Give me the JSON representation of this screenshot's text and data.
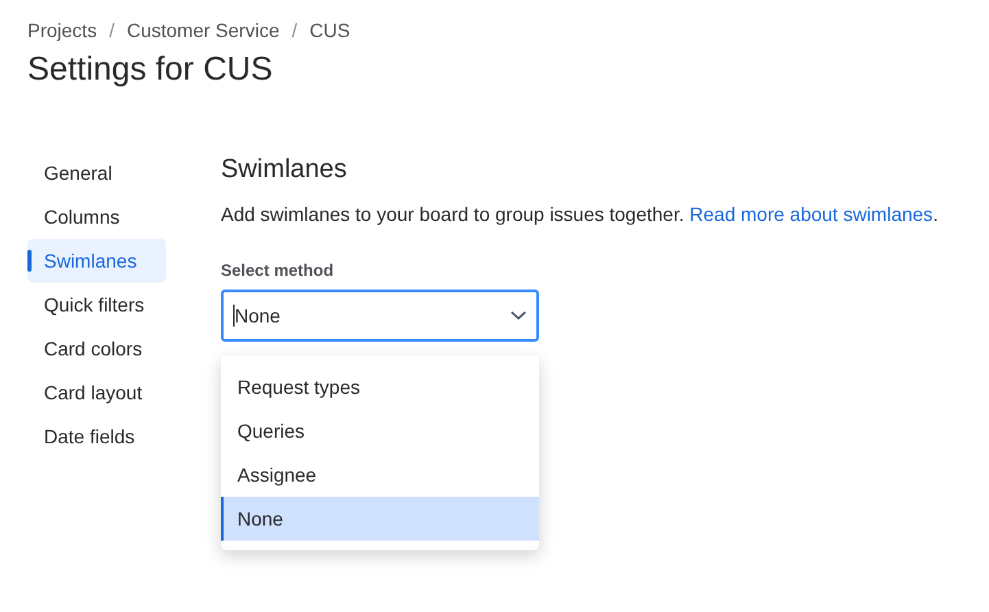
{
  "breadcrumbs": [
    "Projects",
    "Customer Service",
    "CUS"
  ],
  "breadcrumb_separators": [
    "/",
    "/"
  ],
  "title": "Settings for CUS",
  "sidebar": {
    "items": [
      {
        "label": "General",
        "selected": false
      },
      {
        "label": "Columns",
        "selected": false
      },
      {
        "label": "Swimlanes",
        "selected": true
      },
      {
        "label": "Quick filters",
        "selected": false
      },
      {
        "label": "Card colors",
        "selected": false
      },
      {
        "label": "Card layout",
        "selected": false
      },
      {
        "label": "Date fields",
        "selected": false
      }
    ]
  },
  "section": {
    "heading": "Swimlanes",
    "description": "Add swimlanes to your board to group issues together.",
    "link": "Read more about swimlanes",
    "link_suffix": "."
  },
  "select": {
    "label": "Select method",
    "value": "None",
    "options": [
      {
        "label": "Request types",
        "selected": false
      },
      {
        "label": "Queries",
        "selected": false
      },
      {
        "label": "Assignee",
        "selected": false
      },
      {
        "label": "None",
        "selected": true
      }
    ]
  }
}
